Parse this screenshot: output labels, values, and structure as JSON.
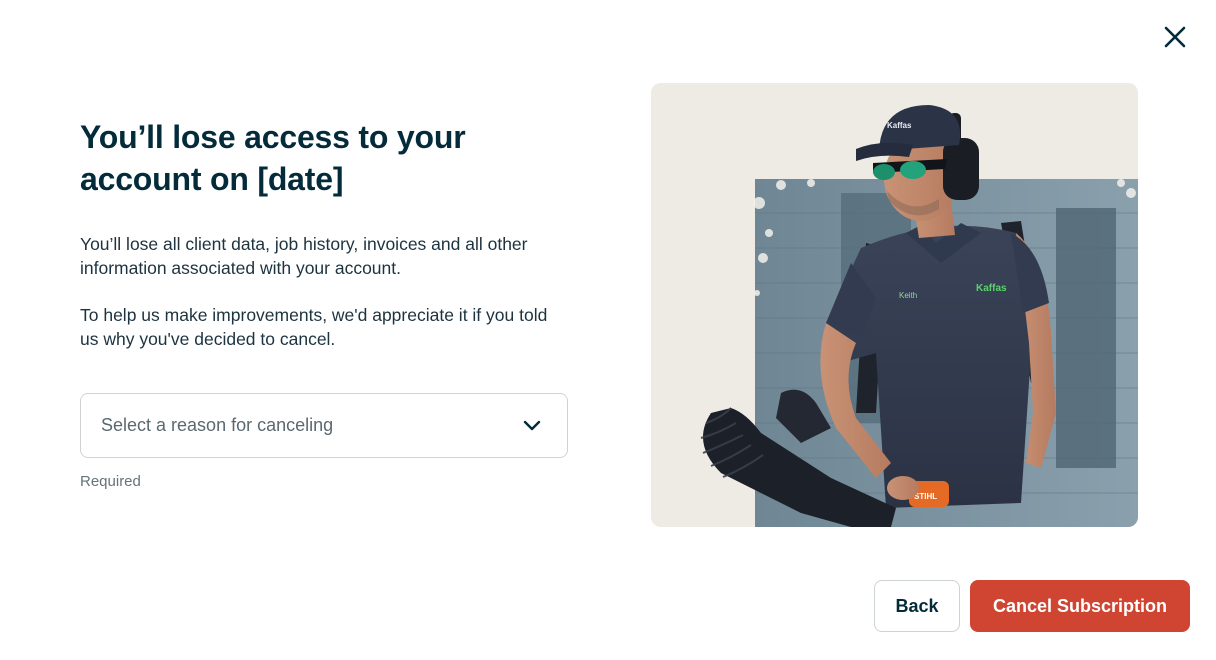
{
  "dialog": {
    "title": "You’ll lose access to your account on [date]",
    "paragraph1": "You’ll lose all client data, job history, invoices and all other information associated with your account.",
    "paragraph2": "To help us make improvements, we'd appreciate it if you told us why you've decided to cancel.",
    "select": {
      "placeholder": "Select a reason for canceling",
      "helper": "Required"
    },
    "image": {
      "shirt_name": "Keith",
      "cap_logo": "Kaffas",
      "blower_brand": "STIHL"
    },
    "buttons": {
      "back": "Back",
      "cancel_subscription": "Cancel Subscription"
    },
    "colors": {
      "primary_text": "#032b3a",
      "danger": "#cf4532"
    },
    "icons": {
      "close": "close-icon",
      "dropdown": "chevron-down-icon"
    }
  }
}
